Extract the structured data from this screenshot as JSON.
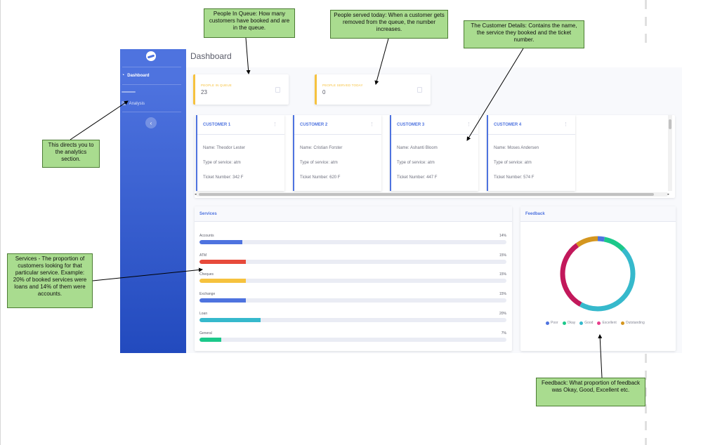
{
  "sidebar": {
    "brand_icon": "logo-icon",
    "items": [
      {
        "label": "Dashboard",
        "icon": "tachometer-icon"
      },
      {
        "label": "Analysis",
        "icon": "chart-icon"
      }
    ],
    "toggle_icon": "chevron-left-icon"
  },
  "header": {
    "title": "Dashboard"
  },
  "stats": [
    {
      "label": "PEOPLE IN QUEUE",
      "value": "23",
      "icon": "calendar-icon"
    },
    {
      "label": "PEOPLE SERVED TODAY",
      "value": "0",
      "icon": "calendar-icon"
    }
  ],
  "customers": [
    {
      "title": "CUSTOMER 1",
      "name": "Name: Theodor Lester",
      "service": "Type of service: atm",
      "ticket": "Ticket Number: 342 F"
    },
    {
      "title": "CUSTOMER 2",
      "name": "Name: Cristian Forster",
      "service": "Type of service: atm",
      "ticket": "Ticket Number: 620 F"
    },
    {
      "title": "CUSTOMER 3",
      "name": "Name: Ashanti Bloom",
      "service": "Type of service: atm",
      "ticket": "Ticket Number: 447 F"
    },
    {
      "title": "CUSTOMER 4",
      "name": "Name: Moses Andersen",
      "service": "Type of service: atm",
      "ticket": "Ticket Number: 574 F"
    }
  ],
  "services": {
    "title": "Services",
    "items": [
      {
        "name": "Accounts",
        "pct_label": "14%",
        "value": 14,
        "color": "#4e73df"
      },
      {
        "name": "ATM",
        "pct_label": "15%",
        "value": 15,
        "color": "#e74a3b"
      },
      {
        "name": "Cheques",
        "pct_label": "15%",
        "value": 15,
        "color": "#f6c23e"
      },
      {
        "name": "Exchange",
        "pct_label": "15%",
        "value": 15,
        "color": "#4e73df"
      },
      {
        "name": "Loan",
        "pct_label": "20%",
        "value": 20,
        "color": "#36b9cc"
      },
      {
        "name": "General",
        "pct_label": "7%",
        "value": 7,
        "color": "#1cc88a"
      }
    ]
  },
  "feedback": {
    "title": "Feedback",
    "legend": [
      {
        "label": "Poor",
        "color": "#4e73df"
      },
      {
        "label": "Okay",
        "color": "#1cc88a"
      },
      {
        "label": "Good",
        "color": "#36b9cc"
      },
      {
        "label": "Excellent",
        "color": "#e83e8c"
      },
      {
        "label": "Outstanding",
        "color": "#d4961f"
      }
    ]
  },
  "chart_data": {
    "type": "pie",
    "title": "Feedback",
    "categories": [
      "Poor",
      "Okay",
      "Good",
      "Excellent",
      "Outstanding"
    ],
    "values": [
      3,
      10,
      45,
      32,
      10
    ],
    "colors": [
      "#4e73df",
      "#1cc88a",
      "#36b9cc",
      "#c2185b",
      "#d4961f"
    ],
    "legend": "bottom"
  },
  "annotations": {
    "queue": "People In Queue: How many customers have booked and are in the queue.",
    "served": "People served today: When a customer gets removed from the queue, the number increases.",
    "customer": "The Customer Details: Contains the name, the service they booked and the ticket number.",
    "analytics": "This directs you to the analytics section.",
    "services": "Services - The proportion of customers looking for that particular service. Example: 20% of booked services were loans and 14% of them were accounts.",
    "feedback": "Feedback: What proportion of feedback was Okay, Good, Excellent etc."
  }
}
